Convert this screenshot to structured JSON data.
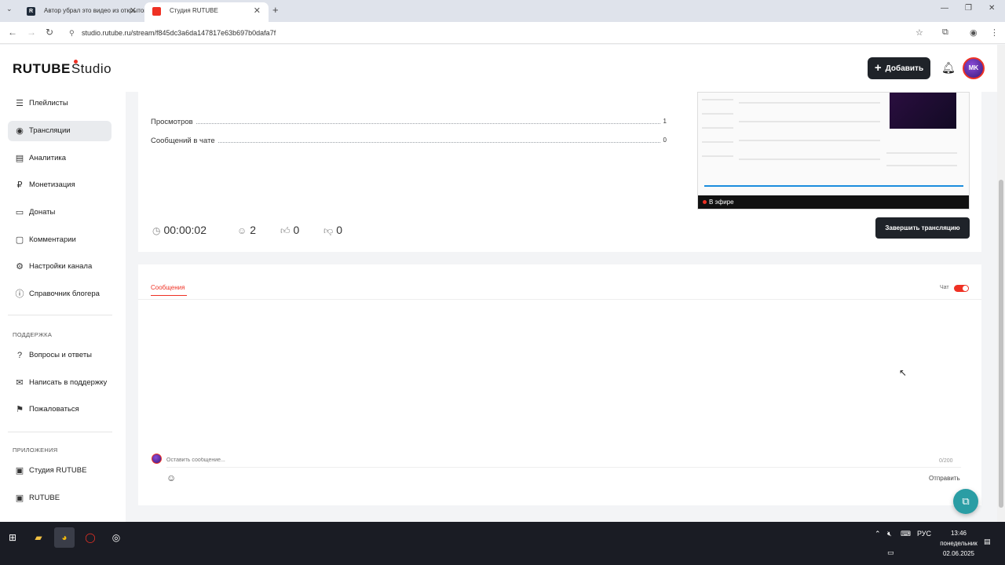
{
  "browser": {
    "tabs": [
      {
        "title": "Автор убрал это видео из открытого доступа",
        "icon": "R"
      },
      {
        "title": "Студия RUTUBE",
        "active": true
      }
    ],
    "new_tab": "+",
    "url": "studio.rutube.ru/stream/f845dc3a6da147817e63b697b0dafa7f"
  },
  "header": {
    "logo": "RUTUBE",
    "logo_suffix": "Studio",
    "add_button": "Добавить",
    "avatar_text": "MK"
  },
  "sidebar": {
    "items": [
      {
        "label": "Плейлисты",
        "icon": "playlist-icon"
      },
      {
        "label": "Трансляции",
        "icon": "broadcast-icon",
        "active": true
      },
      {
        "label": "Аналитика",
        "icon": "analytics-icon"
      },
      {
        "label": "Монетизация",
        "icon": "ruble-icon"
      },
      {
        "label": "Донаты",
        "icon": "donate-icon"
      },
      {
        "label": "Комментарии",
        "icon": "comment-icon"
      },
      {
        "label": "Настройки канала",
        "icon": "gear-icon"
      },
      {
        "label": "Справочник блогера",
        "icon": "info-icon"
      }
    ],
    "support_heading": "ПОДДЕРЖКА",
    "support_items": [
      {
        "label": "Вопросы и ответы",
        "icon": "faq-icon"
      },
      {
        "label": "Написать в поддержку",
        "icon": "mail-icon"
      },
      {
        "label": "Пожаловаться",
        "icon": "flag-icon"
      }
    ],
    "apps_heading": "ПРИЛОЖЕНИЯ",
    "apps_items": [
      {
        "label": "Студия RUTUBE",
        "icon": "studio-app-icon"
      },
      {
        "label": "RUTUBE",
        "icon": "rutube-app-icon"
      }
    ]
  },
  "stream": {
    "stats": [
      {
        "label": "Просмотров",
        "value": "1"
      },
      {
        "label": "Сообщений в чате",
        "value": "0"
      }
    ],
    "duration": "00:00:02",
    "viewers": "2",
    "likes": "0",
    "dislikes": "0",
    "preview_live_label": "В эфире",
    "end_button": "Завершить трансляцию"
  },
  "chat": {
    "tab_label": "Сообщения",
    "toggle_label": "Чат",
    "toggle_on": true,
    "input_placeholder": "Оставить сообщение...",
    "counter": "0/200",
    "send_label": "Отправить"
  },
  "taskbar": {
    "language": "РУС",
    "time": "13:46",
    "weekday": "понедельник",
    "date": "02.06.2025"
  },
  "colors": {
    "accent": "#ef3124",
    "dark_button": "#1f2329",
    "support_fab": "#2a9da4"
  }
}
